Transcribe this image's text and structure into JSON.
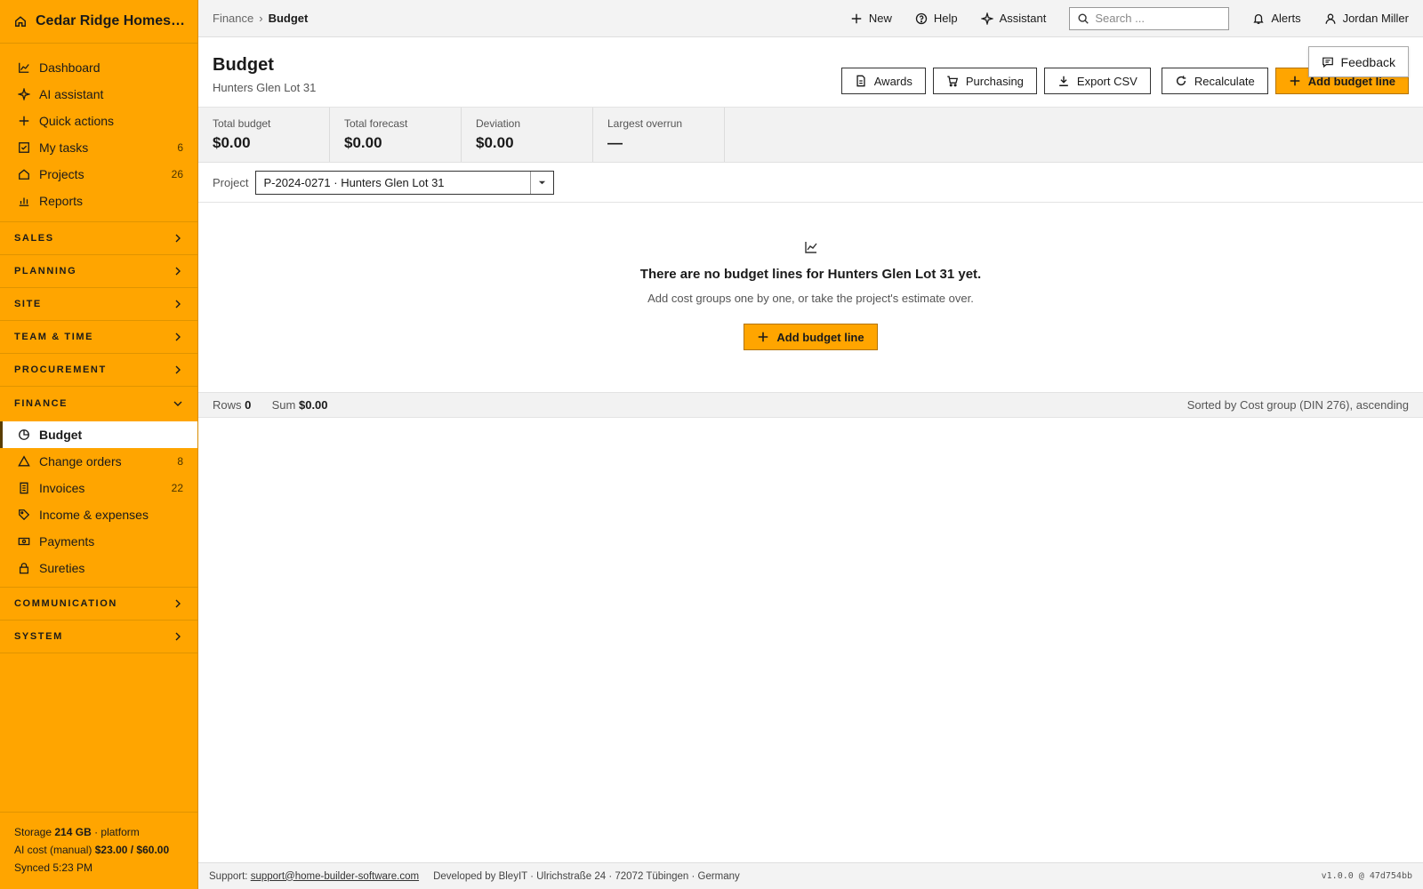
{
  "sidebar": {
    "brand": "Cedar Ridge Homes L...",
    "top_items": [
      {
        "label": "Dashboard",
        "count": ""
      },
      {
        "label": "AI assistant",
        "count": ""
      },
      {
        "label": "Quick actions",
        "count": ""
      },
      {
        "label": "My tasks",
        "count": "6"
      },
      {
        "label": "Projects",
        "count": "26"
      },
      {
        "label": "Reports",
        "count": ""
      }
    ],
    "sections": {
      "sales": "SALES",
      "planning": "PLANNING",
      "site": "SITE",
      "team_time": "TEAM & TIME",
      "procurement": "PROCUREMENT",
      "finance": "FINANCE",
      "communication": "COMMUNICATION",
      "system": "SYSTEM"
    },
    "finance_items": [
      {
        "label": "Budget",
        "count": ""
      },
      {
        "label": "Change orders",
        "count": "8"
      },
      {
        "label": "Invoices",
        "count": "22"
      },
      {
        "label": "Income & expenses",
        "count": ""
      },
      {
        "label": "Payments",
        "count": ""
      },
      {
        "label": "Sureties",
        "count": ""
      }
    ],
    "footer": {
      "storage_label": "Storage",
      "storage_value": "214 GB",
      "storage_suffix": "· platform",
      "ai_label": "AI cost (manual)",
      "ai_value": "$23.00 / $60.00",
      "synced": "Synced 5:23 PM"
    }
  },
  "topbar": {
    "breadcrumb_parent": "Finance",
    "breadcrumb_sep": "›",
    "breadcrumb_current": "Budget",
    "new_label": "New",
    "help_label": "Help",
    "assistant_label": "Assistant",
    "search_placeholder": "Search ...",
    "alerts_label": "Alerts",
    "user_name": "Jordan Miller"
  },
  "header": {
    "title": "Budget",
    "subtitle": "Hunters Glen Lot 31",
    "buttons": {
      "awards": "Awards",
      "purchasing": "Purchasing",
      "export": "Export CSV",
      "recalculate": "Recalculate",
      "add": "Add budget line"
    },
    "feedback": "Feedback"
  },
  "kpis": [
    {
      "label": "Total budget",
      "value": "$0.00"
    },
    {
      "label": "Total forecast",
      "value": "$0.00"
    },
    {
      "label": "Deviation",
      "value": "$0.00"
    },
    {
      "label": "Largest overrun",
      "value": "—"
    }
  ],
  "filter": {
    "label": "Project",
    "value": "P-2024-0271 · Hunters Glen Lot 31"
  },
  "empty_state": {
    "title": "There are no budget lines for Hunters Glen Lot 31 yet.",
    "description": "Add cost groups one by one, or take the project's estimate over.",
    "button": "Add budget line"
  },
  "statusbar": {
    "rows_label": "Rows",
    "rows_value": "0",
    "sum_label": "Sum",
    "sum_value": "$0.00",
    "sort_text": "Sorted by Cost group (DIN 276), ascending"
  },
  "footer": {
    "support_label": "Support:",
    "support_email": "support@home-builder-software.com",
    "developer": "Developed by BleyIT · Ulrichstraße 24 · 72072 Tübingen · Germany",
    "version": "v1.0.0 @ 47d754bb"
  },
  "colors": {
    "accent": "#ffa500",
    "accent_border": "#d98c00"
  }
}
